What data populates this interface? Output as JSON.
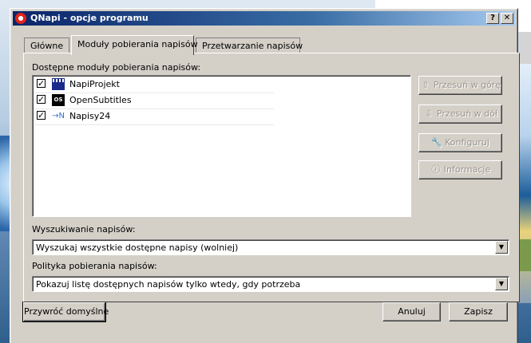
{
  "window": {
    "title": "QNapi - opcje programu",
    "help_label": "?",
    "close_label": "✕"
  },
  "tabs": [
    {
      "label": "Główne"
    },
    {
      "label": "Moduły pobierania napisów"
    },
    {
      "label": "Przetwarzanie napisów"
    }
  ],
  "modules": {
    "label": "Dostępne moduły pobierania napisów:",
    "items": [
      {
        "label": "NapiProjekt",
        "checked": true,
        "icon": "napiprojekt-icon"
      },
      {
        "label": "OpenSubtitles",
        "checked": true,
        "icon": "opensubtitles-icon",
        "icon_text": "OS"
      },
      {
        "label": "Napisy24",
        "checked": true,
        "icon": "napisy24-icon",
        "icon_text": "→N"
      }
    ],
    "check_mark": "✓"
  },
  "side_buttons": [
    {
      "label": "Przesuń w górę",
      "icon": "⇧"
    },
    {
      "label": "Przesuń w dół",
      "icon": "⇩"
    },
    {
      "label": "Konfiguruj",
      "icon": "🔧"
    },
    {
      "label": "Informacje",
      "icon": "ⓘ"
    }
  ],
  "search": {
    "label": "Wyszukiwanie napisów:",
    "value": "Wyszukaj wszystkie dostępne napisy (wolniej)",
    "arrow": "▼"
  },
  "policy": {
    "label": "Polityka pobierania napisów:",
    "value": "Pokazuj listę dostępnych napisów tylko wtedy, gdy potrzeba",
    "arrow": "▼"
  },
  "buttons": {
    "restore": "Przywróć domyślne",
    "cancel": "Anuluj",
    "save": "Zapisz"
  }
}
